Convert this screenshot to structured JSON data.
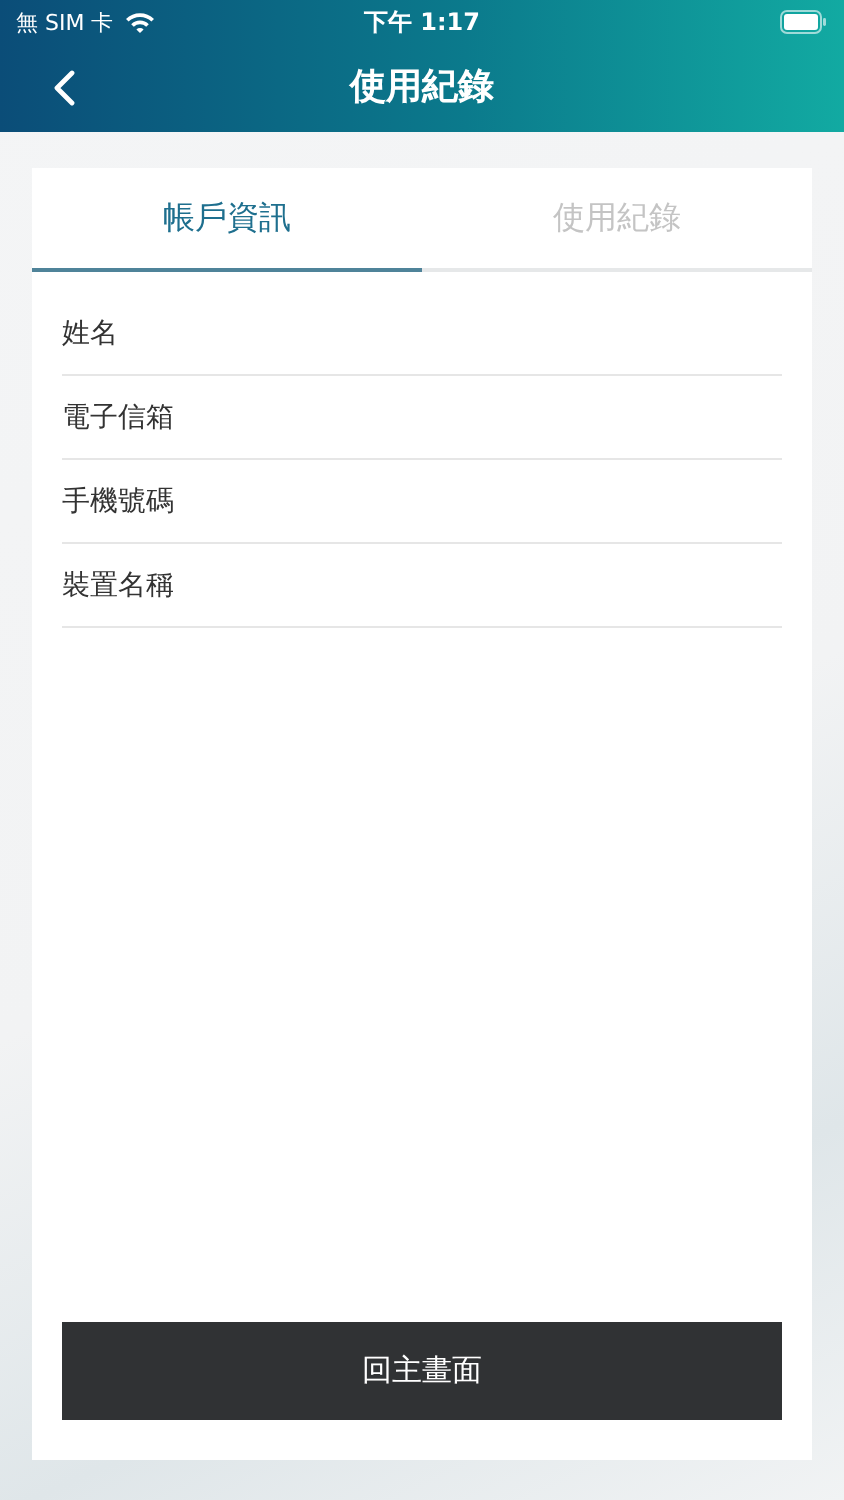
{
  "status_bar": {
    "carrier": "無 SIM 卡",
    "time": "下午 1:17"
  },
  "nav": {
    "title": "使用紀錄"
  },
  "tabs": [
    {
      "label": "帳戶資訊",
      "selected": true
    },
    {
      "label": "使用紀錄",
      "selected": false
    }
  ],
  "fields": [
    {
      "label": "姓名"
    },
    {
      "label": "電子信箱"
    },
    {
      "label": "手機號碼"
    },
    {
      "label": "裝置名稱"
    }
  ],
  "button": "回主畫面"
}
